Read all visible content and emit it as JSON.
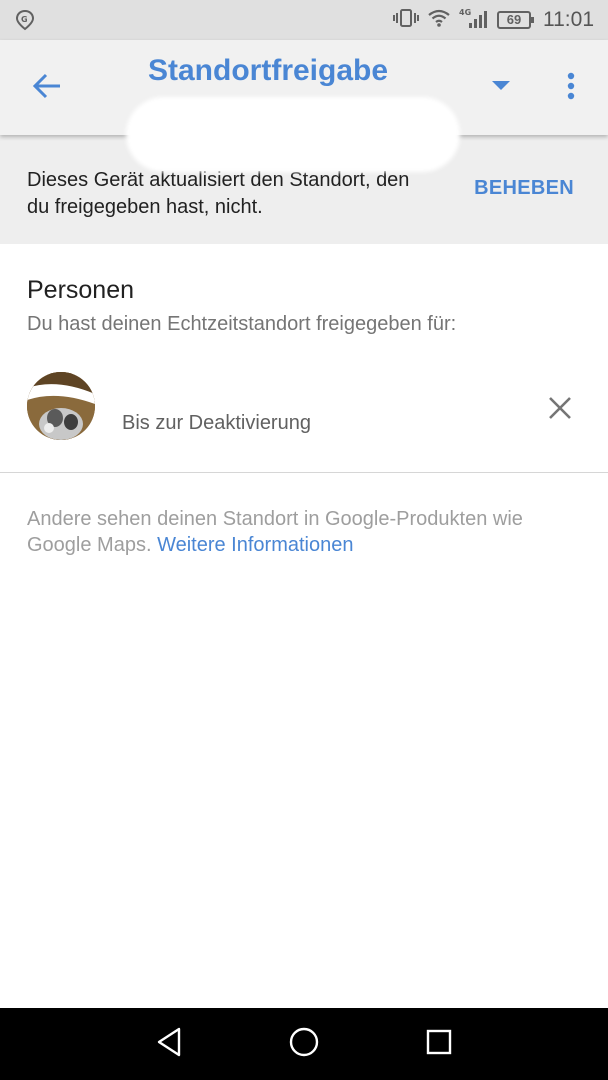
{
  "status_bar": {
    "time": "11:01",
    "battery": "69",
    "network": "4G",
    "icons": [
      "maps-location-icon",
      "vibrate-icon",
      "wifi-icon",
      "cell-signal-icon",
      "battery-icon"
    ]
  },
  "app_bar": {
    "title": "Standortfreigabe",
    "icons": [
      "back-arrow-icon",
      "dropdown-arrow-icon",
      "more-vert-icon"
    ]
  },
  "banner": {
    "message": "Dieses Gerät aktualisiert den Standort, den du freigegeben hast, nicht.",
    "action_label": "BEHEBEN"
  },
  "people": {
    "title": "Personen",
    "subtitle": "Du hast deinen Echtzeitstandort freigegeben für:",
    "items": [
      {
        "status": "Bis zur Deaktivierung"
      }
    ]
  },
  "footer": {
    "text": "Andere sehen deinen Standort in Google-Produkten wie Google Maps.",
    "link_label": "Weitere Informationen"
  },
  "colors": {
    "accent": "#4a86d4",
    "app_bar_bg": "#f1f1f1",
    "banner_bg": "#eeeeee",
    "status_bar_bg": "#e0e0e0"
  },
  "nav_bar": {
    "icons": [
      "back-triangle-icon",
      "home-circle-icon",
      "recents-square-icon"
    ]
  }
}
